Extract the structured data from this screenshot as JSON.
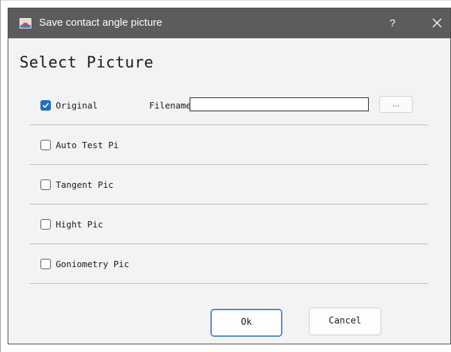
{
  "window": {
    "title": "Save contact angle picture",
    "help_glyph": "?",
    "close_glyph": "✕"
  },
  "heading": "Select Picture",
  "options": [
    {
      "label": "Original",
      "checked": true
    },
    {
      "label": "Auto Test Pi",
      "checked": false
    },
    {
      "label": "Tangent Pic",
      "checked": false
    },
    {
      "label": "Hight Pic",
      "checked": false
    },
    {
      "label": "Goniometry Pic",
      "checked": false
    }
  ],
  "filename": {
    "label": "Filename",
    "value": "",
    "browse_label": "..."
  },
  "buttons": {
    "ok": "Ok",
    "cancel": "Cancel"
  },
  "colors": {
    "titlebar": "#5c5c5c",
    "accent": "#1f6fc4"
  },
  "icons": {
    "app": "app-icon",
    "close": "close-icon",
    "check": "checkmark-icon"
  }
}
